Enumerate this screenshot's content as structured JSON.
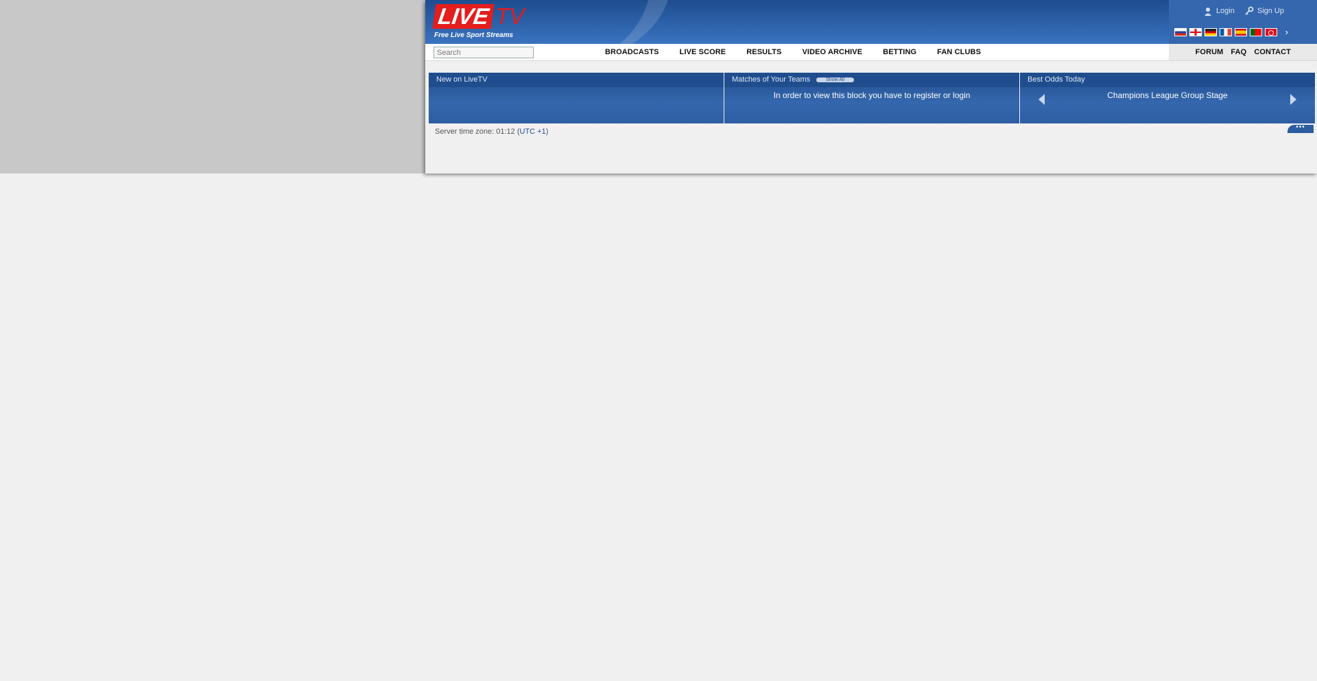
{
  "brand": {
    "logo_live": "LIVE",
    "logo_tv": "TV",
    "tagline": "Free Live Sport Streams"
  },
  "auth": {
    "login": "Login",
    "signup": "Sign Up"
  },
  "languages": [
    "ru",
    "en",
    "de",
    "fr",
    "es",
    "pt",
    "tr"
  ],
  "search": {
    "placeholder": "Search"
  },
  "nav": {
    "main": [
      "BROADCASTS",
      "LIVE SCORE",
      "RESULTS",
      "VIDEO ARCHIVE",
      "BETTING",
      "FAN CLUBS"
    ],
    "right": [
      "FORUM",
      "FAQ",
      "CONTACT"
    ]
  },
  "panels": {
    "new": {
      "title": "New on LiveTV"
    },
    "teams": {
      "title": "Matches of Your Teams",
      "show_all": "Show All",
      "message": "In order to view this block you have to register or login"
    },
    "odds": {
      "title": "Best Odds Today",
      "competition": "Champions League Group Stage"
    }
  },
  "footer": {
    "server_time_prefix": "Server time zone: 01:12 (",
    "utc": "UTC +1",
    "server_time_suffix": ")",
    "more": "•••"
  },
  "colors": {
    "header_blue": "#1e4d8f",
    "logo_red": "#e41d1d",
    "sidebar_gray": "#c8c8c8",
    "page_bg": "#f0f0f0"
  }
}
